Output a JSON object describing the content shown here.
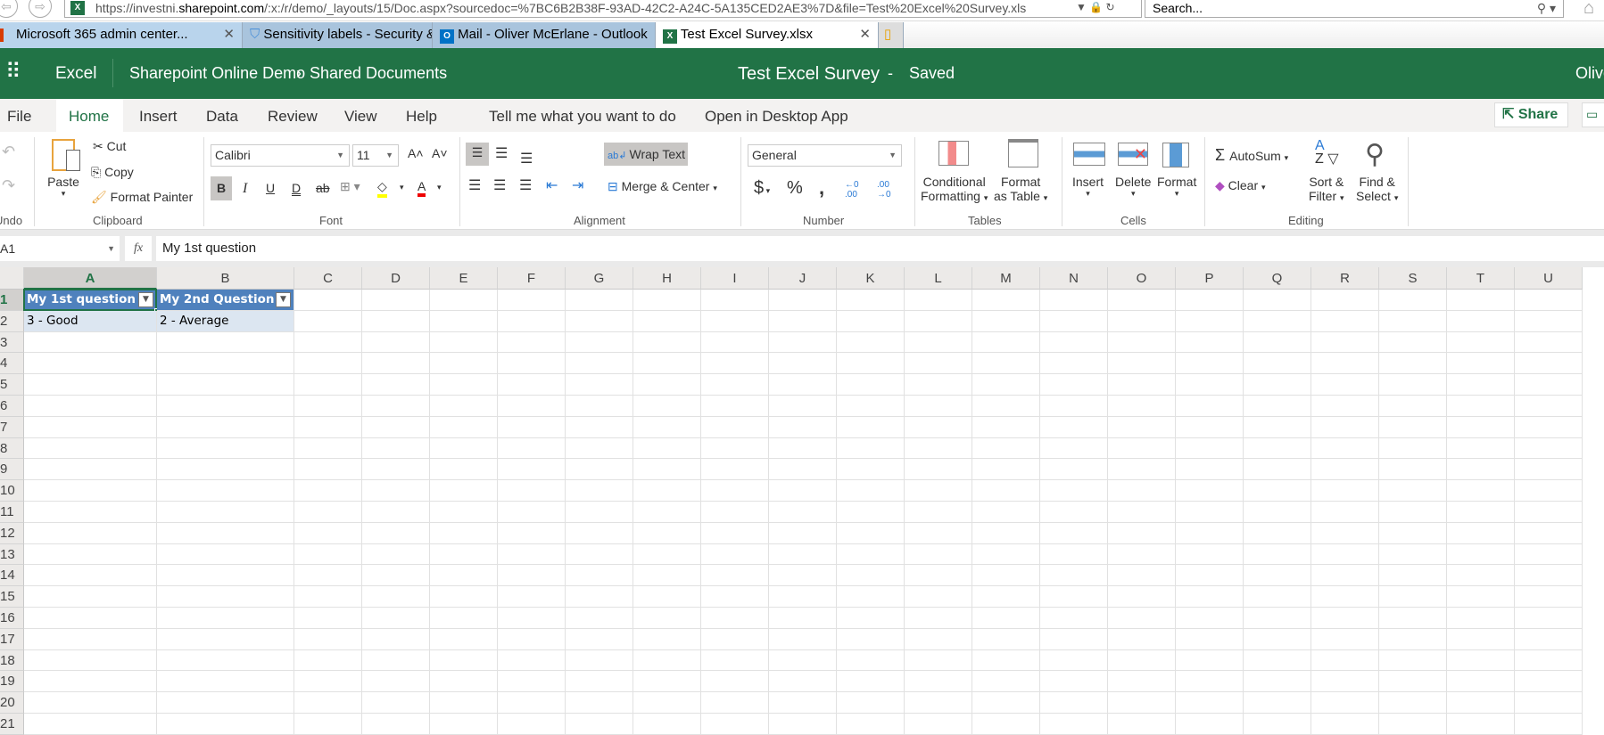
{
  "browser": {
    "url_host_prefix": "https://investni.",
    "url_host": "sharepoint.com",
    "url_rest": "/:x:/r/demo/_layouts/15/Doc.aspx?sourcedoc=%7BC6B2B38F-93AD-42C2-A24C-5A135CED2AE3%7D&file=Test%20Excel%20Survey.xls",
    "search_placeholder": "Search...",
    "tabs": [
      {
        "label": "Microsoft 365 admin center..."
      },
      {
        "label": "Sensitivity labels - Security & C..."
      },
      {
        "label": "Mail - Oliver McErlane - Outlook"
      },
      {
        "label": "Test Excel Survey.xlsx"
      }
    ]
  },
  "header": {
    "app": "Excel",
    "breadcrumb1": "Sharepoint Online Demo",
    "breadcrumb2": "Shared Documents",
    "doc_title": "Test Excel Survey",
    "sep": "-",
    "status": "Saved",
    "user": "Olive"
  },
  "menu": {
    "items": [
      "File",
      "Home",
      "Insert",
      "Data",
      "Review",
      "View",
      "Help"
    ],
    "tell_me": "Tell me what you want to do",
    "open_desktop": "Open in Desktop App",
    "share": "Share"
  },
  "ribbon": {
    "undo_label": "Undo",
    "paste": "Paste",
    "cut": "Cut",
    "copy": "Copy",
    "format_painter": "Format Painter",
    "clipboard": "Clipboard",
    "font_name": "Calibri",
    "font_size": "11",
    "font": "Font",
    "wrap_text": "Wrap Text",
    "merge_center": "Merge & Center",
    "alignment": "Alignment",
    "number_format": "General",
    "number": "Number",
    "cond_fmt_1": "Conditional",
    "cond_fmt_2": "Formatting",
    "fmt_table_1": "Format",
    "fmt_table_2": "as Table",
    "tables": "Tables",
    "insert": "Insert",
    "delete": "Delete",
    "format": "Format",
    "cells": "Cells",
    "autosum": "AutoSum",
    "clear": "Clear",
    "sort_1": "Sort &",
    "sort_2": "Filter",
    "find_1": "Find &",
    "find_2": "Select",
    "editing": "Editing"
  },
  "formula_bar": {
    "name_box": "A1",
    "fx": "fx",
    "value": "My 1st question"
  },
  "sheet": {
    "columns": [
      "A",
      "B",
      "C",
      "D",
      "E",
      "F",
      "G",
      "H",
      "I",
      "J",
      "K",
      "L",
      "M",
      "N",
      "O",
      "P",
      "Q",
      "R",
      "S",
      "T",
      "U"
    ],
    "row_count": 21,
    "cells": {
      "A1": "My 1st question",
      "B1": "My 2nd Question",
      "A2": "3 - Good",
      "B2": "2 - Average"
    },
    "selected": "A1"
  },
  "colors": {
    "excel_green": "#217346",
    "table_header": "#4f81bd",
    "table_band": "#dce6f1"
  }
}
